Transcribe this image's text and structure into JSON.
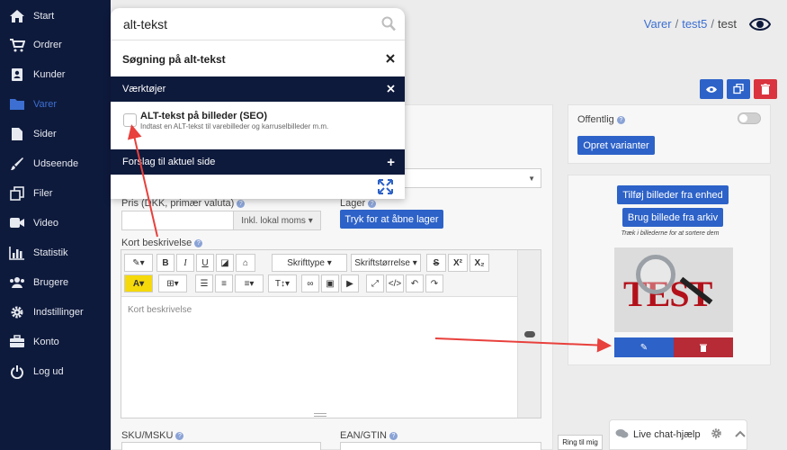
{
  "sidebar": {
    "items": [
      {
        "label": "Start",
        "icon": "home-icon"
      },
      {
        "label": "Ordrer",
        "icon": "cart-icon"
      },
      {
        "label": "Kunder",
        "icon": "user-card-icon"
      },
      {
        "label": "Varer",
        "icon": "folder-icon"
      },
      {
        "label": "Sider",
        "icon": "file-icon"
      },
      {
        "label": "Udseende",
        "icon": "brush-icon"
      },
      {
        "label": "Filer",
        "icon": "copy-icon"
      },
      {
        "label": "Video",
        "icon": "video-icon"
      },
      {
        "label": "Statistik",
        "icon": "bar-chart-icon"
      },
      {
        "label": "Brugere",
        "icon": "users-icon"
      },
      {
        "label": "Indstillinger",
        "icon": "gear-icon"
      },
      {
        "label": "Konto",
        "icon": "briefcase-icon"
      },
      {
        "label": "Log ud",
        "icon": "power-icon"
      }
    ],
    "active": "Varer"
  },
  "breadcrumb": {
    "part1": "Varer",
    "sep": "/",
    "part2": "test5",
    "current": "test"
  },
  "search": {
    "value": "alt-tekst",
    "title": "Søgning på alt-tekst",
    "section_tools": "Værktøjer",
    "result_title": "ALT-tekst på billeder (SEO)",
    "result_desc": "Indtast en ALT-tekst til varebilleder og karruselbilleder m.m.",
    "section_suggestions": "Forslag til aktuel side"
  },
  "form": {
    "price_label": "Pris (DKK, primær valuta)",
    "price_unit": "Inkl. lokal moms",
    "stock_label": "Lager",
    "stock_button": "Tryk for at åbne lager",
    "short_desc_label": "Kort beskrivelse",
    "editor_placeholder": "Kort beskrivelse",
    "font_family": "Skrifttype",
    "font_size": "Skriftstørrelse",
    "sku_label": "SKU/MSKU",
    "ean_label": "EAN/GTIN"
  },
  "side": {
    "public_label": "Offentlig",
    "variants_button": "Opret varianter",
    "add_images": "Tilføj billeder fra enhed",
    "use_archive": "Brug billede fra arkiv",
    "drag_hint": "Træk i billederne for at sortere dem",
    "image_text": "TEST"
  },
  "footer": {
    "ring": "Ring til mig",
    "chat": "Live chat-hjælp"
  },
  "colors": {
    "sidebar": "#0e1a3c",
    "accent": "#2d62c8",
    "danger": "#d9343f",
    "annotation": "#e8403c"
  }
}
